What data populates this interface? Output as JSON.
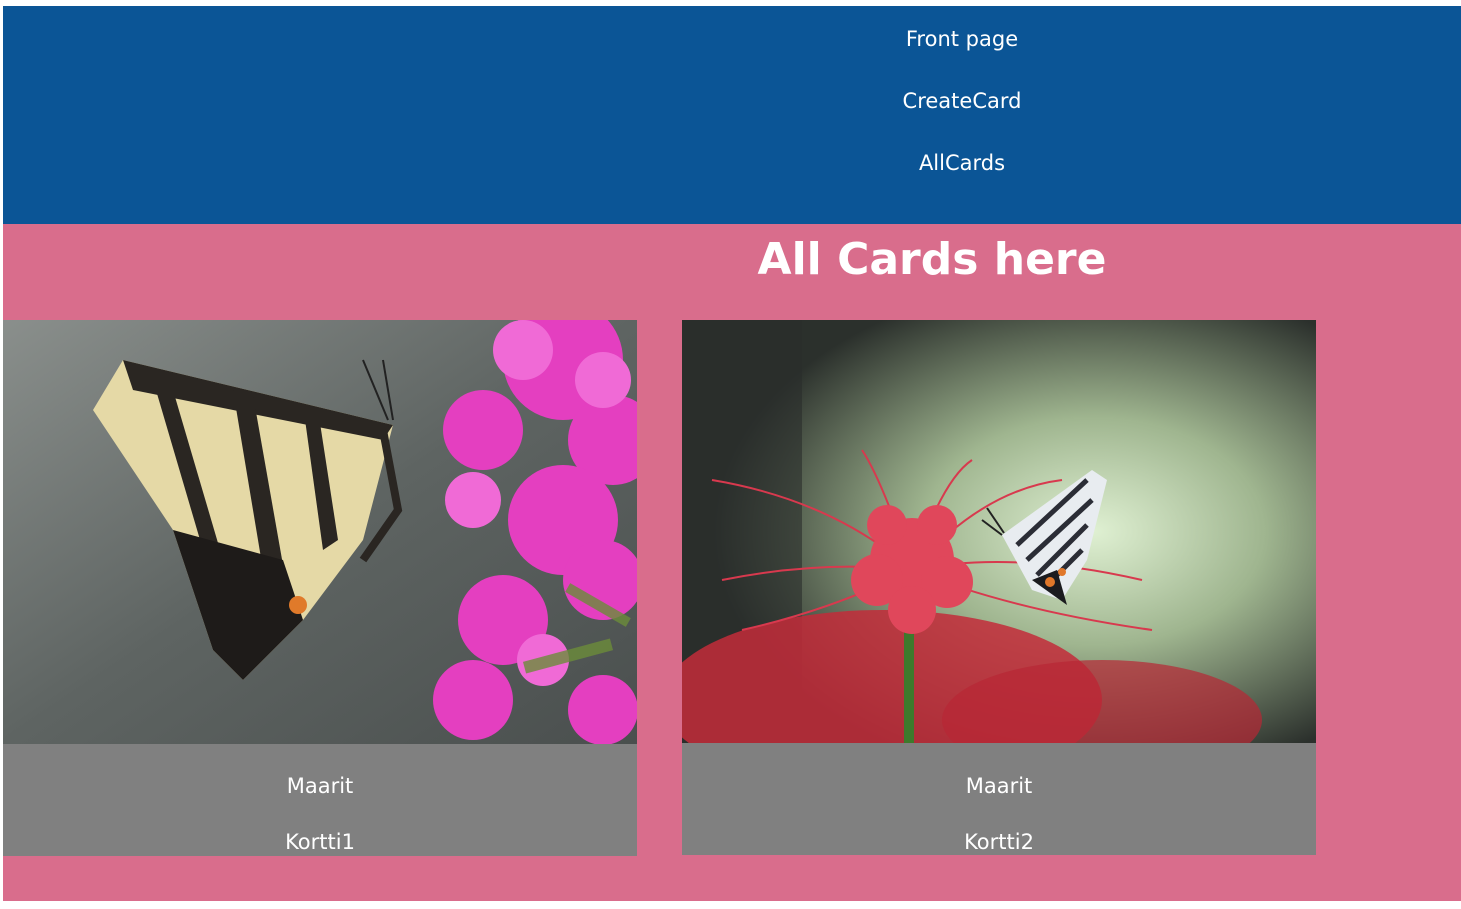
{
  "nav": {
    "items": [
      {
        "label": "Front page"
      },
      {
        "label": "CreateCard"
      },
      {
        "label": "AllCards"
      }
    ],
    "background": "#0b5596"
  },
  "main": {
    "title": "All Cards here",
    "background": "#d96d8c"
  },
  "cards": [
    {
      "author": "Maarit",
      "name": "Kortti1",
      "image": "swallowtail-butterfly-on-pink-flowers"
    },
    {
      "author": "Maarit",
      "name": "Kortti2",
      "image": "butterfly-on-red-spider-lily"
    }
  ],
  "colors": {
    "card_footer": "#808080",
    "text": "#ffffff"
  }
}
